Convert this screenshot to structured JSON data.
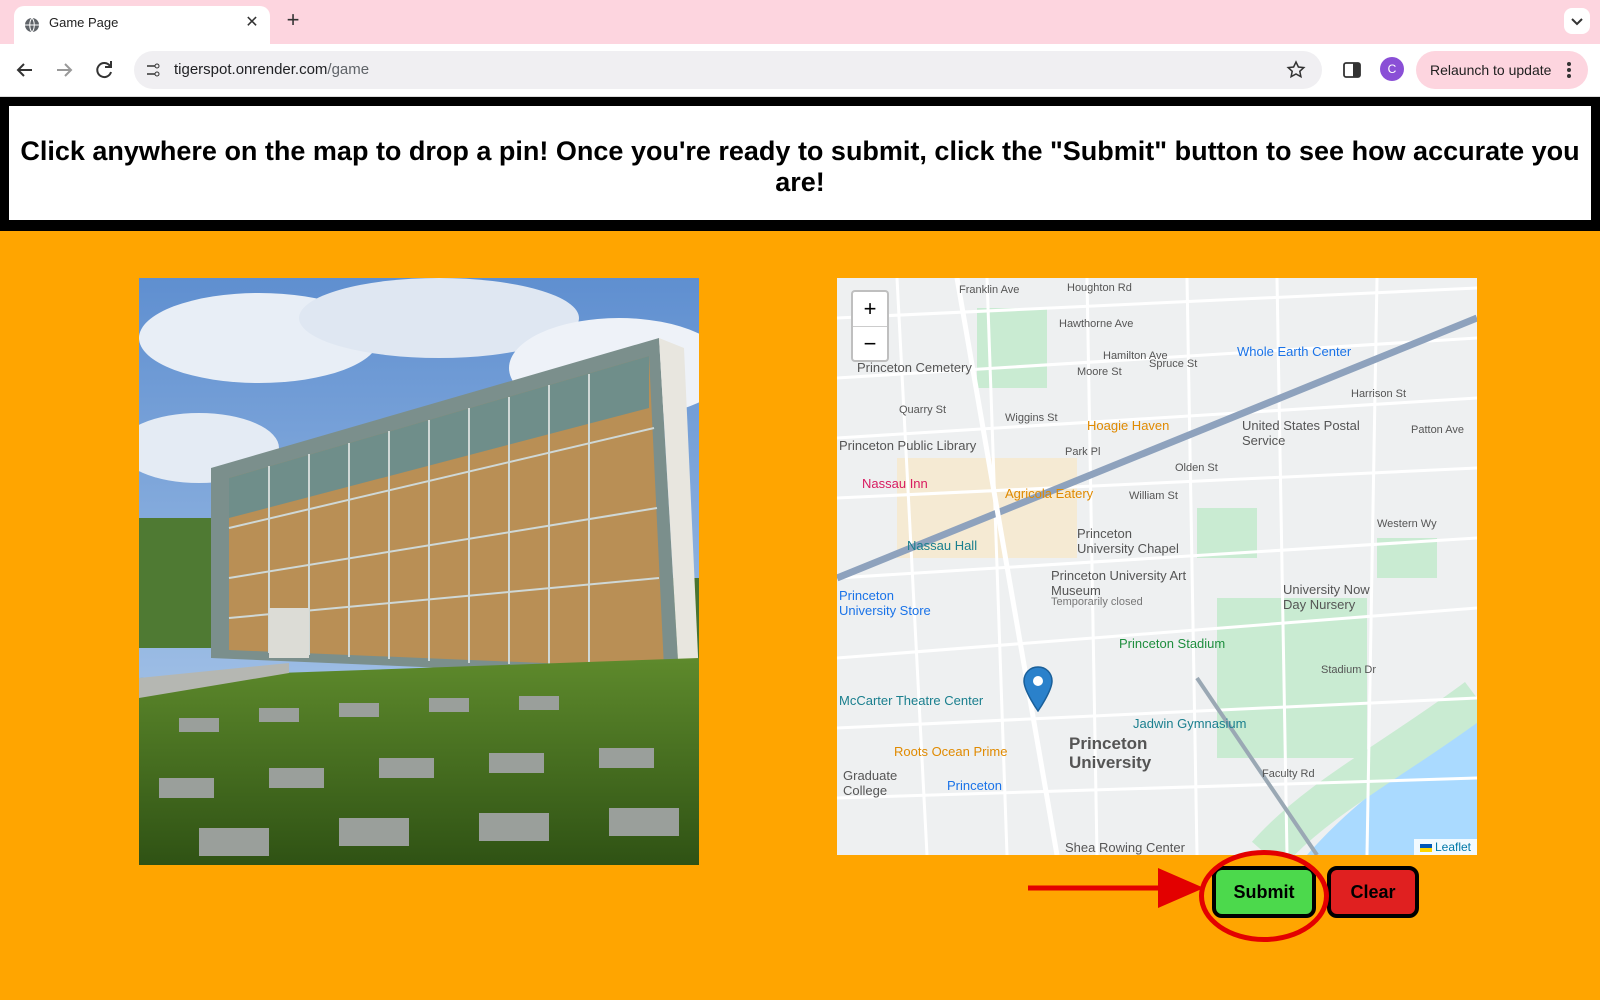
{
  "browser": {
    "tab_title": "Game Page",
    "url_host": "tigerspot.onrender.com",
    "url_path": "/game",
    "relaunch_label": "Relaunch to update",
    "profile_initial": "C"
  },
  "banner": {
    "instruction": "Click anywhere on the map to drop a pin! Once you're ready to submit, click the \"Submit\" button to see how accurate you are!"
  },
  "map": {
    "zoom_in": "+",
    "zoom_out": "−",
    "attribution": "Leaflet",
    "places": [
      "Princeton Cemetery",
      "Hoagie Haven",
      "United States Postal Service",
      "Whole Earth Center",
      "Nassau Inn",
      "Agricola Eatery",
      "Nassau Hall",
      "Princeton University Chapel",
      "Princeton University Art Museum",
      "Temporarily closed",
      "Princeton Stadium",
      "University Now Day Nursery",
      "Jadwin Gymnasium",
      "Roots Ocean Prime",
      "Princeton University",
      "Graduate College",
      "Princeton",
      "Shea Rowing Center",
      "Princeton Public Library",
      "Princeton University Store",
      "McCarter Theatre Center"
    ],
    "streets": [
      "Franklin Ave",
      "Houghton Rd",
      "Hawthorne Ave",
      "Hamilton Ave",
      "Spruce St",
      "Wiggins St",
      "Park Pl",
      "William St",
      "Harrison St",
      "Patton Ave",
      "Western Wy",
      "Moore St",
      "Quarry St",
      "Olden St",
      "Faculty Rd",
      "Stadium Dr"
    ],
    "pin": "map-pin-marker"
  },
  "buttons": {
    "submit": "Submit",
    "clear": "Clear"
  },
  "colors": {
    "page_background": "#ffa500",
    "submit_button": "#4cd94c",
    "clear_button": "#e02020",
    "annotation": "#e30000"
  }
}
